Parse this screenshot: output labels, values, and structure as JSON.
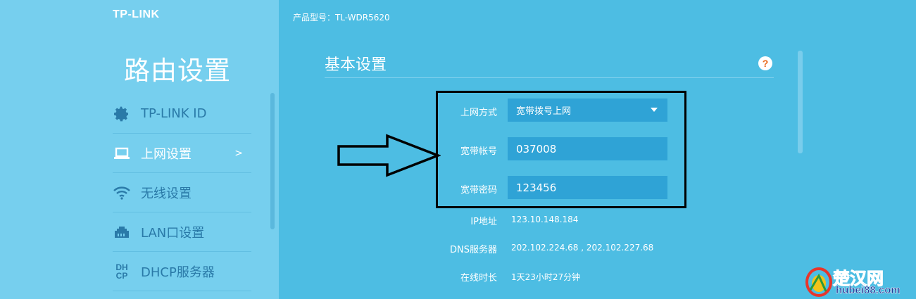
{
  "brand": {
    "logo": "TP-LINK"
  },
  "sidebar": {
    "title": "路由设置",
    "items": [
      {
        "label": "TP-LINK ID",
        "icon": "gear-icon"
      },
      {
        "label": "上网设置",
        "icon": "laptop-icon",
        "arrow": ">"
      },
      {
        "label": "无线设置",
        "icon": "wifi-icon"
      },
      {
        "label": "LAN口设置",
        "icon": "lan-port-icon"
      },
      {
        "label": "DHCP服务器",
        "icon": "dhcp-icon",
        "icon_text_top": "DH",
        "icon_text_bottom": "CP"
      }
    ]
  },
  "header": {
    "model": "产品型号：TL-WDR5620"
  },
  "section": {
    "title": "基本设置",
    "help": "?"
  },
  "form": {
    "wan_type_label": "上网方式",
    "wan_type_value": "宽带拨号上网",
    "account_label": "宽带帐号",
    "account_value": "037008",
    "password_label": "宽带密码",
    "password_value": "123456"
  },
  "status": {
    "ip_label": "IP地址",
    "ip_value": "123.10.148.184",
    "dns_label": "DNS服务器",
    "dns_value": "202.102.224.68 , 202.102.227.68",
    "uptime_label": "在线时长",
    "uptime_value": "1天23小时27分钟"
  },
  "watermark": {
    "name": "楚汉网",
    "url": "hubei88.com"
  },
  "colors": {
    "main_bg": "#4dbde3",
    "sidebar_bg": "#76cfee",
    "field_bg": "#2fa3d6",
    "help_fg": "#e9691b"
  }
}
